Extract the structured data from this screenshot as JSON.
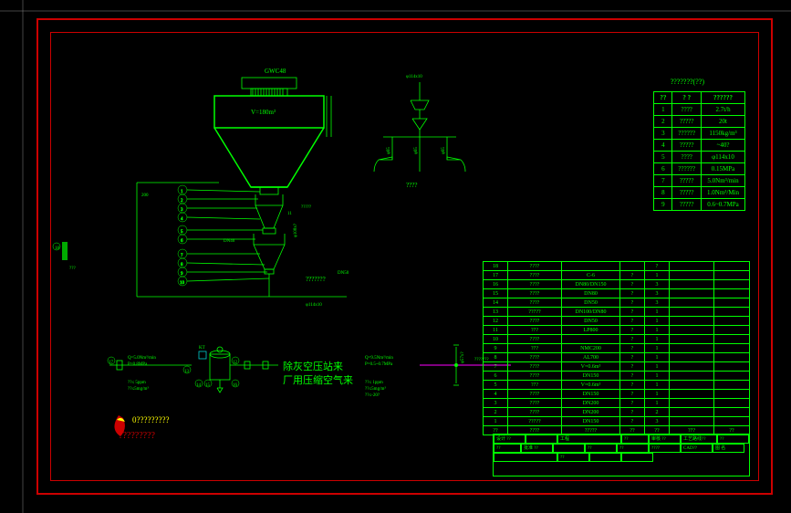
{
  "frame": {
    "param_title": "???????(??)"
  },
  "silo": {
    "label": "GWC48",
    "volume": "V=180m³"
  },
  "assembly": {
    "dn40_label": "DN40",
    "dn50_label": "DN50",
    "phi114_label": "φ114x10",
    "note_right": "???????",
    "note_phi108": "φ108x?"
  },
  "right_assy": {
    "top_label": "φ114x10",
    "bottom_label": "????",
    "phi65_a": "φ65",
    "phi65_b": "φ65",
    "phi65_c": "φ65"
  },
  "lower_left": {
    "spec1": "Q=5.0Nm³/min",
    "spec2": "P=0.8MPa",
    "spec3": "??≤ 5ppm",
    "spec4": "??≤5mg/m³",
    "label_kt": "KT",
    "note_a": "0??0??",
    "note_b": "0??0??"
  },
  "lower_right": {
    "spec1": "Q=9.5Nm³/min",
    "spec2": "P=0.5~0.7MPa",
    "spec3": "??≤ 1ppm",
    "spec4": "??≤5mg/m³",
    "spec5": "??≤-20?",
    "label": "???????",
    "vert": "φ57x?"
  },
  "cn_text": {
    "line1": "除灰空压站来",
    "line2": "厂用压缩空气来"
  },
  "watermark": {
    "line1": "0?????????",
    "line2": "?????????"
  },
  "param_table": {
    "headers": [
      "??",
      "?   ?",
      "??????"
    ],
    "rows": [
      [
        "1",
        "????",
        "2.7t/h"
      ],
      [
        "2",
        "?????",
        "20t"
      ],
      [
        "3",
        "??????",
        "1150kg/m³"
      ],
      [
        "4",
        "?????",
        "~40?"
      ],
      [
        "5",
        "????",
        "φ114x10"
      ],
      [
        "6",
        "??????",
        "0.15MPa"
      ],
      [
        "7",
        "?????",
        "5.0Nm³/min"
      ],
      [
        "8",
        "?????",
        "1.0Nm³/Min"
      ],
      [
        "9",
        "?????",
        "0.6~0.7MPa"
      ]
    ]
  },
  "bom": {
    "rows": [
      [
        "18",
        "????",
        "",
        "",
        "?",
        "",
        ""
      ],
      [
        "17",
        "????",
        "C-6",
        "?",
        "1",
        "",
        ""
      ],
      [
        "16",
        "????",
        "DN80/DN150",
        "?",
        "3",
        "",
        ""
      ],
      [
        "15",
        "????",
        "DN80",
        "?",
        "3",
        "",
        ""
      ],
      [
        "14",
        "????",
        "DN50",
        "?",
        "3",
        "",
        ""
      ],
      [
        "13",
        "?????",
        "DN100/DN80",
        "?",
        "1",
        "",
        ""
      ],
      [
        "12",
        "????",
        "DN50",
        "?",
        "1",
        "",
        ""
      ],
      [
        "11",
        "???",
        "LP800",
        "?",
        "1",
        "",
        ""
      ],
      [
        "10",
        "????",
        "",
        "?",
        "1",
        "",
        ""
      ],
      [
        "9",
        "???",
        "NMC200",
        "?",
        "1",
        "",
        ""
      ],
      [
        "8",
        "????",
        "AL700",
        "?",
        "1",
        "",
        ""
      ],
      [
        "7",
        "????",
        "V=0.6m³",
        "?",
        "1",
        "",
        ""
      ],
      [
        "6",
        "????",
        "DN150",
        "?",
        "1",
        "",
        ""
      ],
      [
        "5",
        "???",
        "V=0.6m³",
        "?",
        "1",
        "",
        ""
      ],
      [
        "4",
        "????",
        "DN150",
        "?",
        "1",
        "",
        ""
      ],
      [
        "3",
        "????",
        "DN200",
        "?",
        "1",
        "",
        ""
      ],
      [
        "2",
        "????",
        "DN200",
        "?",
        "2",
        "",
        ""
      ],
      [
        "1",
        "?????",
        "DN150",
        "?",
        "3",
        "",
        ""
      ],
      [
        "??",
        "????",
        "?????",
        "??",
        "??",
        "???",
        "??"
      ]
    ]
  },
  "title_block": {
    "fields": [
      "设计 ??",
      "",
      "工程",
      "??",
      "审核 ??",
      "工艺路线??",
      "??",
      "??",
      "批准 ??",
      "",
      "??",
      "??",
      "????",
      "CAD??",
      "图 名",
      "",
      "??",
      "",
      ""
    ]
  }
}
